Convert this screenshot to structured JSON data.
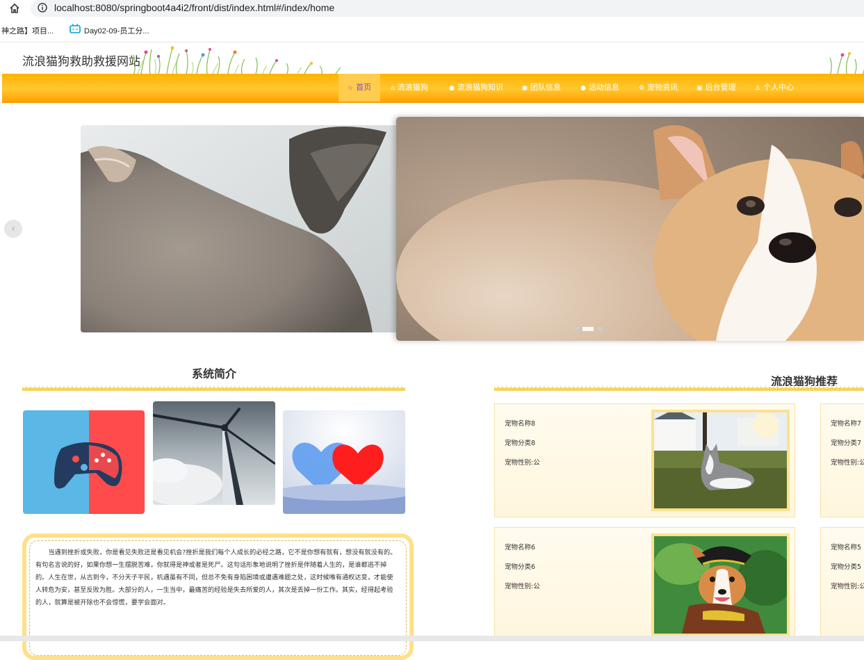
{
  "browser": {
    "url": "localhost:8080/springboot4a4i2/front/dist/index.html#/index/home",
    "bookmarks": [
      "神之路】项目...",
      "Day02-09-员工分..."
    ]
  },
  "site": {
    "title": "流浪猫狗救助救援网站"
  },
  "nav": {
    "items": [
      {
        "label": "首页",
        "icon": "star-icon",
        "active": true
      },
      {
        "label": "流浪猫狗",
        "icon": "bag-icon"
      },
      {
        "label": "流浪猫狗知识",
        "icon": "info-circle-icon"
      },
      {
        "label": "团队信息",
        "icon": "info-circle-icon"
      },
      {
        "label": "活动信息",
        "icon": "info-circle-icon"
      },
      {
        "label": "宠物资讯",
        "icon": "gear-icon"
      },
      {
        "label": "后台管理",
        "icon": "lock-icon"
      },
      {
        "label": "个人中心",
        "icon": "user-icon"
      }
    ]
  },
  "carousel": {
    "prev_label": "‹",
    "slides": [
      "cat",
      "corgi-puppy",
      "extra"
    ],
    "active_index": 1
  },
  "intro": {
    "title": "系统简介",
    "text": "当遇到挫折或失败，你是看见失败还是看见机会?挫折是我们每个人成长的必经之路，它不是你想有就有，想没有就没有的。有句名言说的好，如果你想一生摆脱苦难，你就得是神或者是死尸。这句话形象地说明了挫折是伴随着人生的，是谁都逃不掉的。人生在世，从古到今，不分天子平民，机遇虽有不同，但总不免有身陷困境或遭遇难题之处，这时候唯有通权达变，才能使人转危为安，甚至反败为胜。大部分的人，一生当中，最痛苦的经验是失去所爱的人，其次是丢掉一份工作。其实，经得起考验的人，就算是被开除也不会惊慌，要学会面对。"
  },
  "recommend": {
    "title": "流浪猫狗推荐",
    "cards": [
      {
        "name": "宠物名称8",
        "category": "宠物分类8",
        "gender": "宠物性别:公"
      },
      {
        "name": "宠物名称7",
        "category": "宠物分类7",
        "gender": "宠物性别:公"
      },
      {
        "name": "宠物名称6",
        "category": "宠物分类6",
        "gender": "宠物性别:公"
      },
      {
        "name": "宠物名称5",
        "category": "宠物分类5",
        "gender": "宠物性别:公"
      }
    ]
  },
  "colors": {
    "nav_orange": "#ffb300",
    "active_text": "#8b4ad6",
    "scallop_yellow": "#f6d35d"
  }
}
